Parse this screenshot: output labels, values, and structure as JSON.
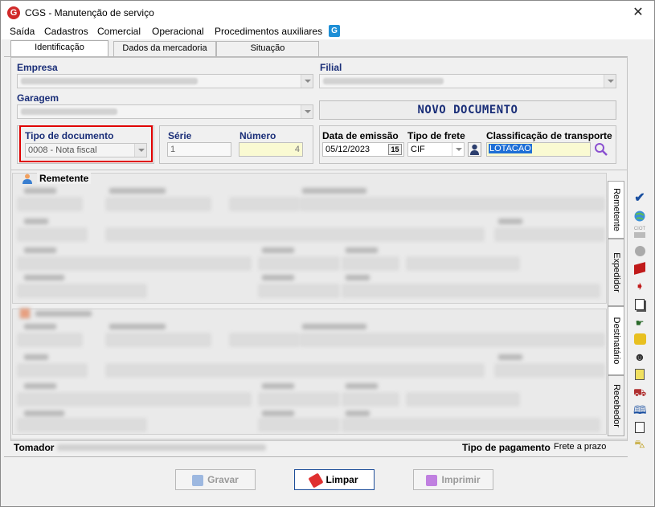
{
  "window": {
    "title": "CGS - Manutenção de serviço",
    "close": "✕"
  },
  "menu": [
    "Saída",
    "Cadastros",
    "Comercial",
    "Operacional",
    "Procedimentos auxiliares"
  ],
  "tabs": [
    {
      "label": "Identificação",
      "active": true
    },
    {
      "label": "Dados da mercadoria",
      "active": false
    },
    {
      "label": "Situação",
      "active": false
    }
  ],
  "form": {
    "empresa_label": "Empresa",
    "filial_label": "Filial",
    "garagem_label": "Garagem",
    "status_banner": "NOVO DOCUMENTO",
    "tipo_documento": {
      "label": "Tipo de documento",
      "value": "0008 - Nota fiscal"
    },
    "serie": {
      "label": "Série",
      "value": "1"
    },
    "numero": {
      "label": "Número",
      "value": "4"
    },
    "data_emissao": {
      "label": "Data de emissão",
      "value": "05/12/2023",
      "calendar": "15"
    },
    "tipo_frete": {
      "label": "Tipo de frete",
      "value": "CIF"
    },
    "classificacao": {
      "label": "Classificação de transporte",
      "value": "LOTACAO"
    }
  },
  "sections": {
    "remetente_label": "Remetente"
  },
  "side_tabs": [
    "Remetente",
    "Expedidor",
    "Destinatário",
    "Recebedor"
  ],
  "toolbar_icons": [
    "check-icon",
    "globe-icon",
    "ciot-icon",
    "circle-icon",
    "boxes-icon",
    "arrow-doc-icon",
    "pages-icon",
    "pointer-icon",
    "people-icon",
    "person-icon",
    "calculator-icon",
    "truck-icon",
    "book-icon",
    "document-icon",
    "car-icon"
  ],
  "footer": {
    "tomador_label": "Tomador",
    "tipo_pagamento_label": "Tipo de pagamento",
    "tipo_pagamento_value": "Frete a prazo"
  },
  "buttons": {
    "gravar": "Gravar",
    "limpar": "Limpar",
    "imprimir": "Imprimir"
  },
  "colors": {
    "label_blue": "#1a2e78",
    "highlight_red": "#e00000",
    "input_yellow": "#fafad2",
    "selected_blue": "#1e6fd6"
  }
}
